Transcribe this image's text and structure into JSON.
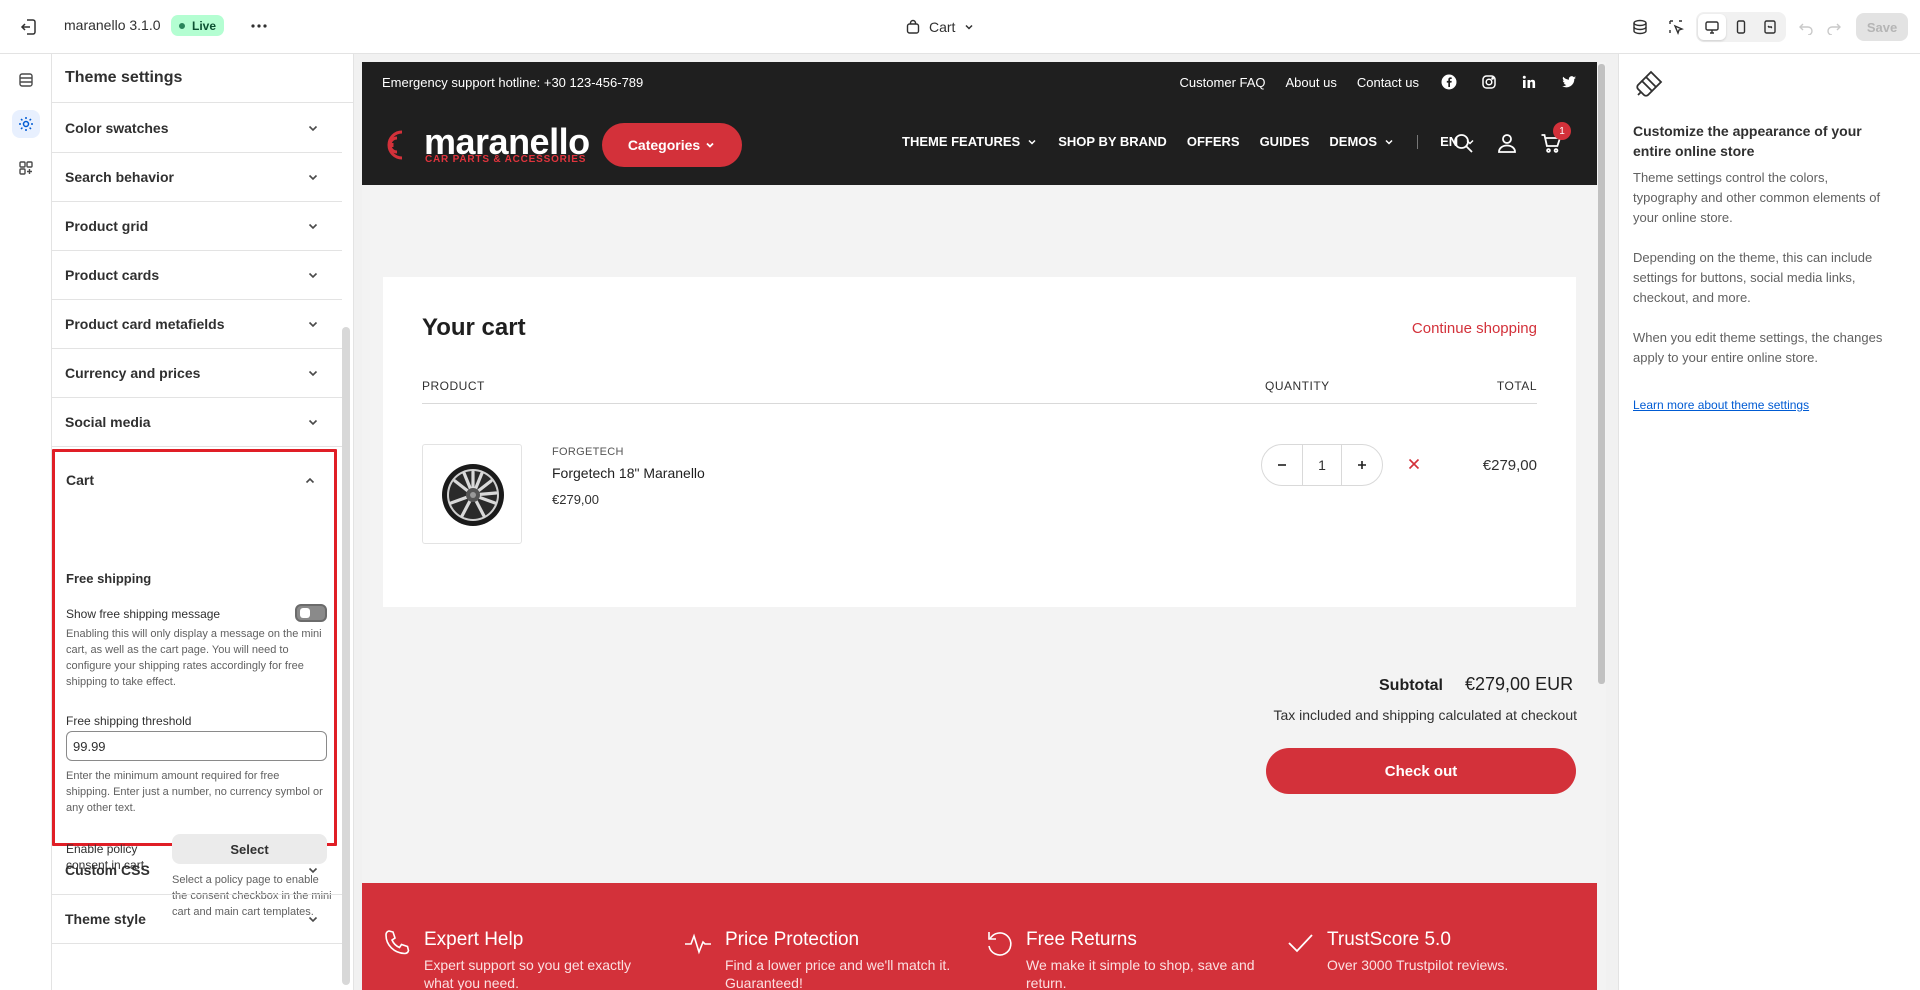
{
  "topbar": {
    "store_name": "maranello 3.1.0",
    "live_label": "Live",
    "page_label": "Cart",
    "save_label": "Save"
  },
  "panel": {
    "title": "Theme settings",
    "sections": [
      {
        "label": "Color swatches"
      },
      {
        "label": "Search behavior"
      },
      {
        "label": "Product grid"
      },
      {
        "label": "Product cards"
      },
      {
        "label": "Product card metafields"
      },
      {
        "label": "Currency and prices"
      },
      {
        "label": "Social media"
      }
    ],
    "cart": {
      "label": "Cart",
      "subheading": "Free shipping",
      "toggle_label": "Show free shipping message",
      "toggle_help": "Enabling this will only display a message on the mini cart, as well as the cart page. You will need to configure your shipping rates accordingly for free shipping to take effect.",
      "threshold_label": "Free shipping threshold",
      "threshold_value": "99.99",
      "threshold_help": "Enter the minimum amount required for free shipping. Enter just a number, no currency symbol or any other text.",
      "policy_label": "Enable policy consent in cart",
      "select_label": "Select",
      "select_help": "Select a policy page to enable the consent checkbox in the mini cart and main cart templates."
    },
    "bottom_sections": [
      {
        "label": "Custom CSS"
      },
      {
        "label": "Theme style"
      }
    ]
  },
  "store": {
    "hotline": "Emergency support hotline: +30 123-456-789",
    "top_links": [
      "Customer FAQ",
      "About us",
      "Contact us"
    ],
    "logo_name": "maranello",
    "logo_sub": "CAR PARTS & ACCESSORIES",
    "categories_label": "Categories",
    "nav": [
      "THEME FEATURES",
      "SHOP BY BRAND",
      "OFFERS",
      "GUIDES",
      "DEMOS"
    ],
    "language": "EN",
    "cart_count": "1",
    "cart": {
      "title": "Your cart",
      "continue_label": "Continue shopping",
      "col_product": "PRODUCT",
      "col_quantity": "QUANTITY",
      "col_total": "TOTAL",
      "item": {
        "brand": "FORGETECH",
        "name": "Forgetech 18\" Maranello",
        "price": "€279,00",
        "quantity": "1",
        "total": "€279,00"
      },
      "subtotal_label": "Subtotal",
      "subtotal_value": "€279,00 EUR",
      "tax_note": "Tax included and shipping calculated at checkout",
      "checkout_label": "Check out"
    },
    "features": [
      {
        "title": "Expert Help",
        "desc": "Expert support so you get exactly what you need."
      },
      {
        "title": "Price Protection",
        "desc": "Find a lower price and we'll match it. Guaranteed!"
      },
      {
        "title": "Free Returns",
        "desc": "We make it simple to shop, save and return."
      },
      {
        "title": "TrustScore 5.0",
        "desc": "Over 3000 Trustpilot reviews."
      }
    ]
  },
  "info": {
    "title": "Customize the appearance of your entire online store",
    "p1": "Theme settings control the colors, typography and other common elements of your online store.",
    "p2": "Depending on the theme, this can include settings for buttons, social media links, checkout, and more.",
    "p3": "When you edit theme settings, the changes apply to your entire online store.",
    "link": "Learn more about theme settings"
  },
  "colors": {
    "brand_red": "#d3313a",
    "highlight_border": "#e01e26",
    "dark_header": "#1f1f1f",
    "live_badge": "#b4fed2",
    "link_blue": "#005bd3"
  }
}
